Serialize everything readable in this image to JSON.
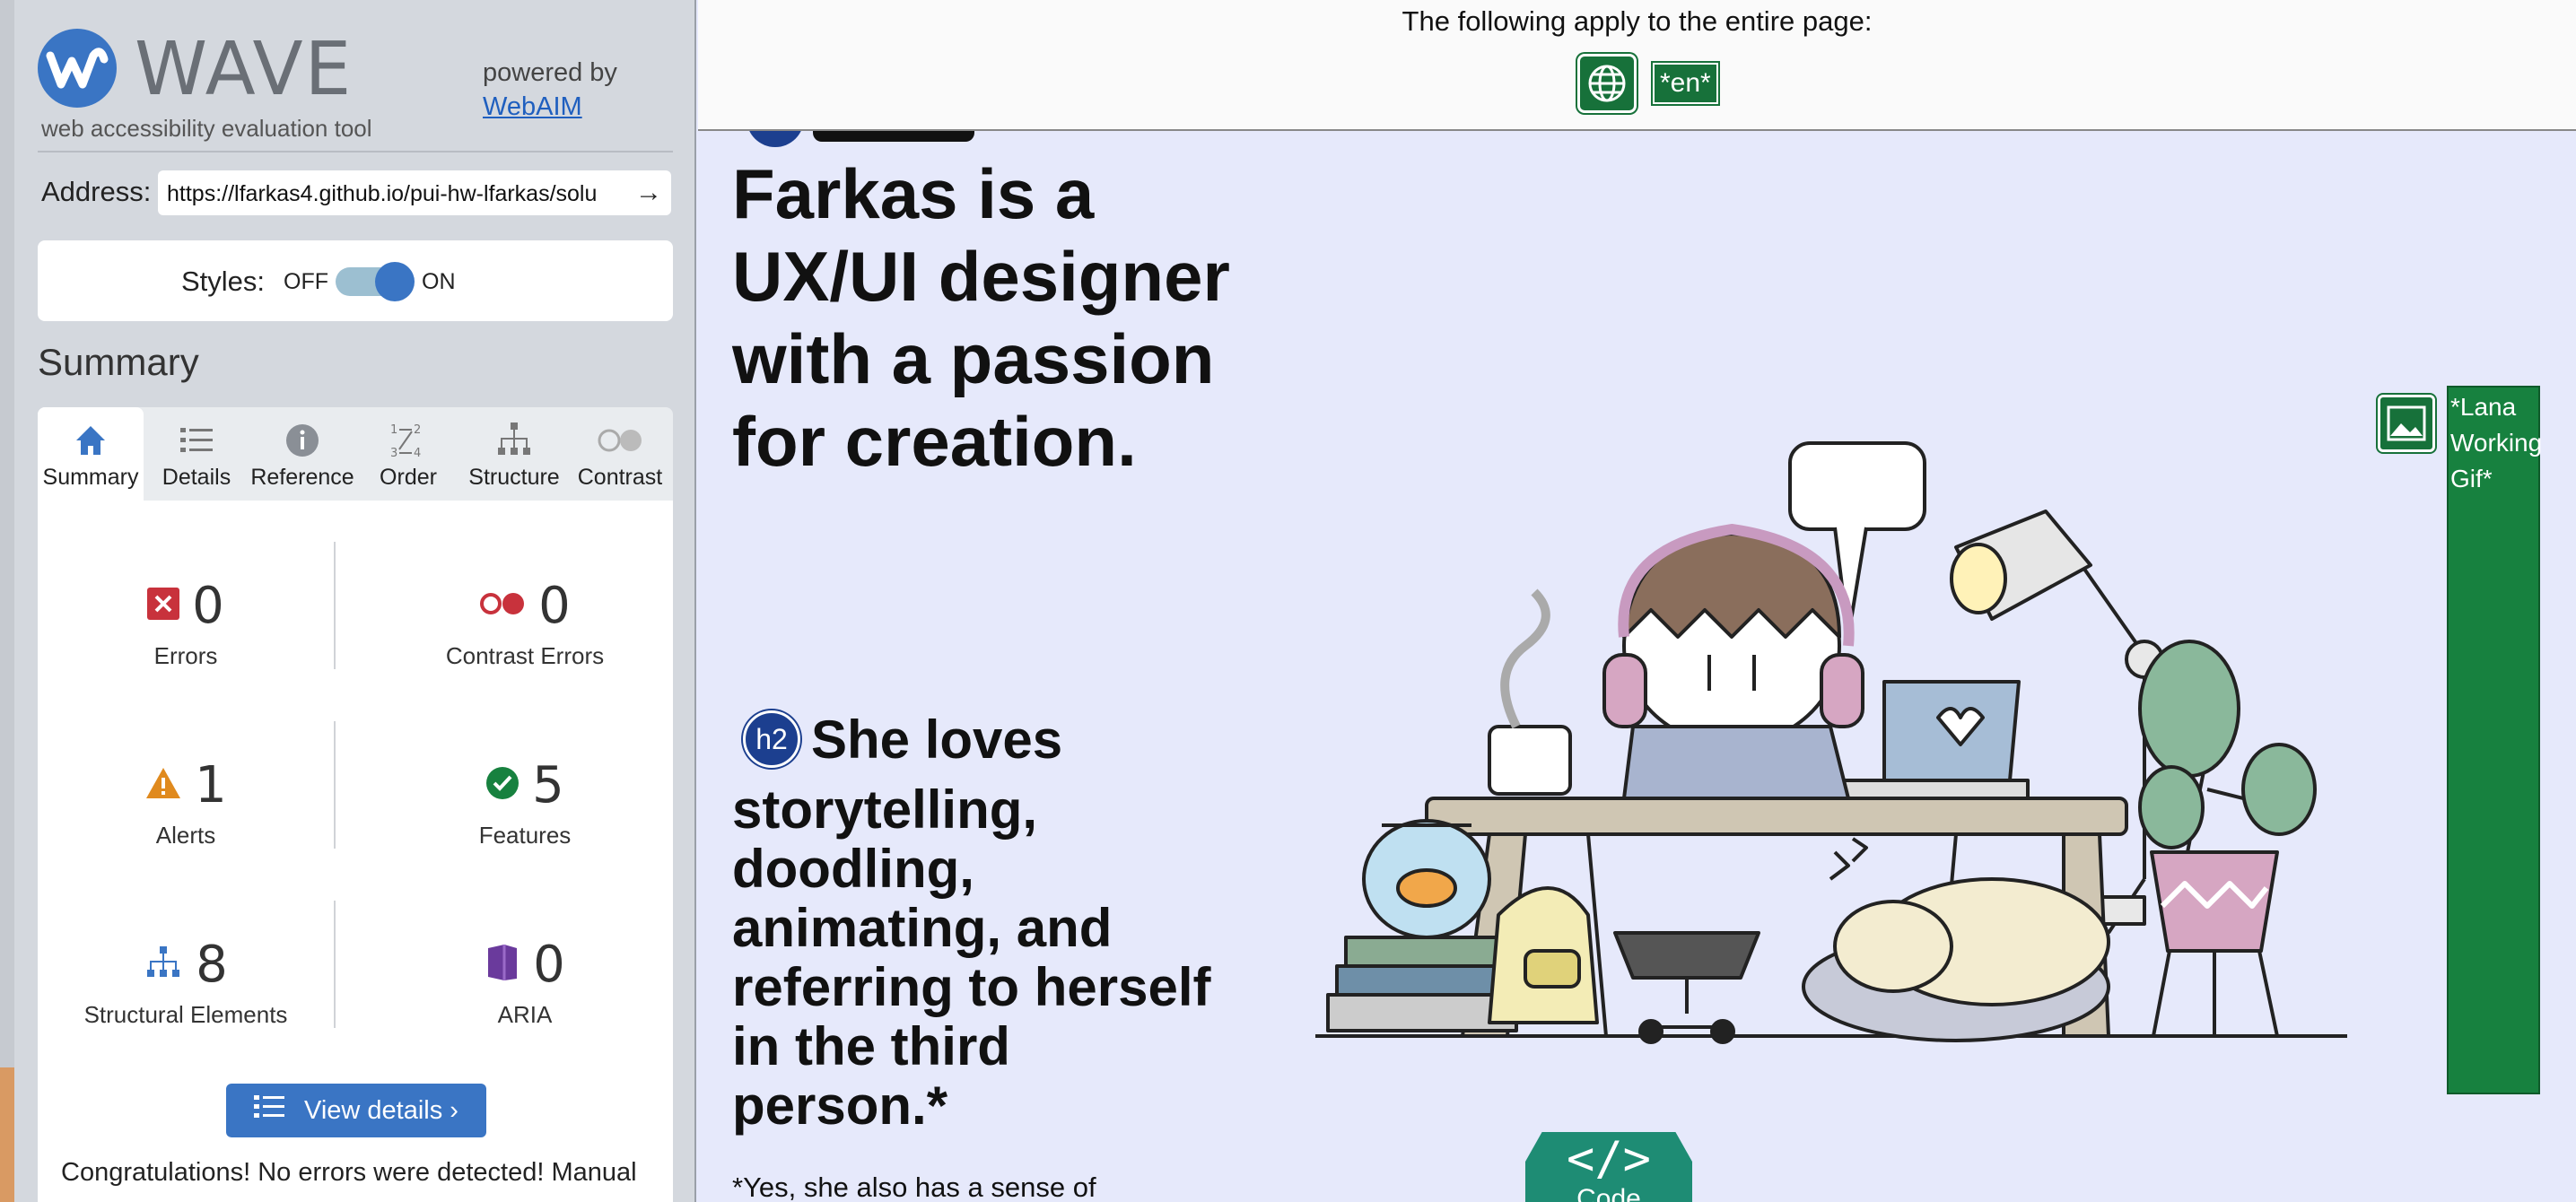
{
  "wave": {
    "brand": "WAVE",
    "tagline": "web accessibility evaluation tool",
    "powered_by": "powered by",
    "powered_link": "WebAIM",
    "address_label": "Address:",
    "address_value": "https://lfarkas4.github.io/pui-hw-lfarkas/solu",
    "styles_label": "Styles:",
    "styles_off": "OFF",
    "styles_on": "ON",
    "summary_title": "Summary",
    "tabs": [
      {
        "label": "Summary",
        "icon": "home-icon"
      },
      {
        "label": "Details",
        "icon": "list-icon"
      },
      {
        "label": "Reference",
        "icon": "info-icon"
      },
      {
        "label": "Order",
        "icon": "order-icon"
      },
      {
        "label": "Structure",
        "icon": "structure-icon"
      },
      {
        "label": "Contrast",
        "icon": "contrast-icon"
      }
    ],
    "stats": {
      "errors": {
        "value": "0",
        "label": "Errors"
      },
      "contrast_errors": {
        "value": "0",
        "label": "Contrast Errors"
      },
      "alerts": {
        "value": "1",
        "label": "Alerts"
      },
      "features": {
        "value": "5",
        "label": "Features"
      },
      "structural": {
        "value": "8",
        "label": "Structural Elements"
      },
      "aria": {
        "value": "0",
        "label": "ARIA"
      }
    },
    "view_details": "View details ›",
    "congrats": "Congratulations! No errors were detected! Manual"
  },
  "page": {
    "topbar_text": "The following apply to the entire page:",
    "lang_badge": "*en*",
    "heading": "Farkas is a UX/UI designer with a passion for creation.",
    "h2_badge": "h2",
    "h2_first": "She loves",
    "h2_rest": "storytelling, doodling, animating, and referring to herself in the third person.*",
    "footnote": "*Yes, she also has a sense of",
    "alt_text": "*Lana Working Gif*",
    "code_label": "Code",
    "code_symbol": "</>"
  },
  "colors": {
    "wave_blue": "#3a75c4",
    "feature_green": "#17713a",
    "error_red": "#c8323c",
    "alert_orange": "#e08a1e",
    "aria_purple": "#6a3a9c",
    "page_bg": "#e6e9fb"
  }
}
